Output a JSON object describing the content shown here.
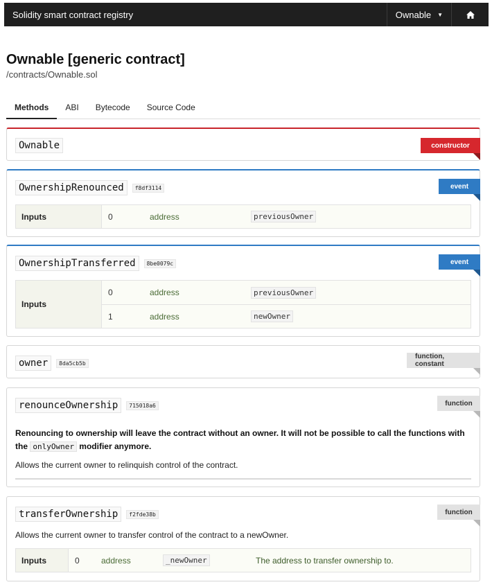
{
  "navbar": {
    "brand": "Solidity smart contract registry",
    "dropdown_label": "Ownable",
    "home_icon": "home-icon"
  },
  "header": {
    "title": "Ownable [generic contract]",
    "path": "/contracts/Ownable.sol"
  },
  "tabs": [
    {
      "label": "Methods",
      "active": true
    },
    {
      "label": "ABI",
      "active": false
    },
    {
      "label": "Bytecode",
      "active": false
    },
    {
      "label": "Source Code",
      "active": false
    }
  ],
  "colors": {
    "constructor": "#d6272d",
    "event": "#2f7bc4",
    "function": "#e2e2e2"
  },
  "methods": {
    "constructor": {
      "name": "Ownable",
      "badge": "constructor"
    },
    "ownership_renounced": {
      "name": "OwnershipRenounced",
      "hash": "f8df3114",
      "badge": "event",
      "inputs_label": "Inputs",
      "inputs": [
        {
          "index": "0",
          "type": "address",
          "name": "previousOwner"
        }
      ]
    },
    "ownership_transferred": {
      "name": "OwnershipTransferred",
      "hash": "8be0079c",
      "badge": "event",
      "inputs_label": "Inputs",
      "inputs": [
        {
          "index": "0",
          "type": "address",
          "name": "previousOwner"
        },
        {
          "index": "1",
          "type": "address",
          "name": "newOwner"
        }
      ]
    },
    "owner": {
      "name": "owner",
      "hash": "8da5cb5b",
      "badge": "function, constant"
    },
    "renounce_ownership": {
      "name": "renounceOwnership",
      "hash": "715018a6",
      "badge": "function",
      "notice_part1": "Renouncing to ownership will leave the contract without an owner. It will not be possible to call the functions with the",
      "notice_code": "onlyOwner",
      "notice_part2": "modifier anymore.",
      "description": "Allows the current owner to relinquish control of the contract."
    },
    "transfer_ownership": {
      "name": "transferOwnership",
      "hash": "f2fde38b",
      "badge": "function",
      "description": "Allows the current owner to transfer control of the contract to a newOwner.",
      "inputs_label": "Inputs",
      "inputs": [
        {
          "index": "0",
          "type": "address",
          "name": "_newOwner",
          "description": "The address to transfer ownership to."
        }
      ]
    }
  }
}
